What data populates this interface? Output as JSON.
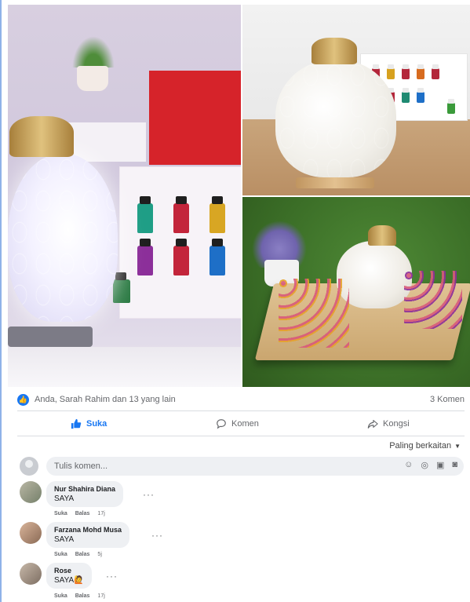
{
  "post": {
    "reactions_text": "Anda, Sarah Rahim dan 13 yang lain",
    "comment_count": "3 Komen"
  },
  "actions": {
    "like_label": "Suka",
    "comment_label": "Komen",
    "share_label": "Kongsi"
  },
  "sort_label": "Paling berkaitan",
  "composer": {
    "placeholder": "Tulis komen..."
  },
  "comments": [
    {
      "name": "Nur Shahira Diana",
      "text": "SAYA",
      "like": "Suka",
      "reply": "Balas",
      "time": "17j"
    },
    {
      "name": "Farzana Mohd Musa",
      "text": "SAYA",
      "like": "Suka",
      "reply": "Balas",
      "time": "5j"
    },
    {
      "name": "Rose",
      "text": "SAYA🙋",
      "like": "Suka",
      "reply": "Balas",
      "time": "17j"
    }
  ],
  "colors": {
    "accent": "#1877f2",
    "bubble": "#eef0f3",
    "muted": "#65676b"
  }
}
